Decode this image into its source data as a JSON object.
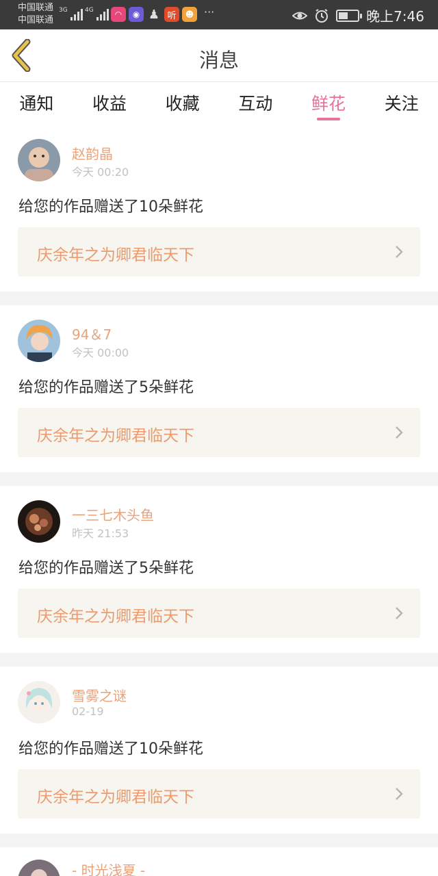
{
  "status_bar": {
    "carrier_1": "中国联通",
    "carrier_2": "中国联通",
    "net_1": "3G",
    "net_2": "4G",
    "time": "晚上7:46",
    "battery_percent": 45
  },
  "header": {
    "title": "消息"
  },
  "tabs": [
    {
      "label": "通知",
      "active": false
    },
    {
      "label": "收益",
      "active": false
    },
    {
      "label": "收藏",
      "active": false
    },
    {
      "label": "互动",
      "active": false
    },
    {
      "label": "鲜花",
      "active": true
    },
    {
      "label": "关注",
      "active": false
    }
  ],
  "items": [
    {
      "username": "赵韵晶",
      "time": "今天 00:20",
      "message": "给您的作品赠送了10朵鲜花",
      "work_title": "庆余年之为卿君临天下"
    },
    {
      "username": "94＆7",
      "time": "今天 00:00",
      "message": "给您的作品赠送了5朵鲜花",
      "work_title": "庆余年之为卿君临天下"
    },
    {
      "username": "一三七木头鱼",
      "time": "昨天 21:53",
      "message": "给您的作品赠送了5朵鲜花",
      "work_title": "庆余年之为卿君临天下"
    },
    {
      "username": "雪雾之谜",
      "time": "02-19",
      "message": "给您的作品赠送了10朵鲜花",
      "work_title": "庆余年之为卿君临天下"
    }
  ],
  "partial_item": {
    "username": "- 时光浅夏 -"
  },
  "colors": {
    "accent_pink": "#e7739a",
    "name_orange": "#e9a27a",
    "work_orange": "#eb9b6d",
    "link_bg": "#f6f5ef",
    "back_arrow": "#e8c24a"
  }
}
